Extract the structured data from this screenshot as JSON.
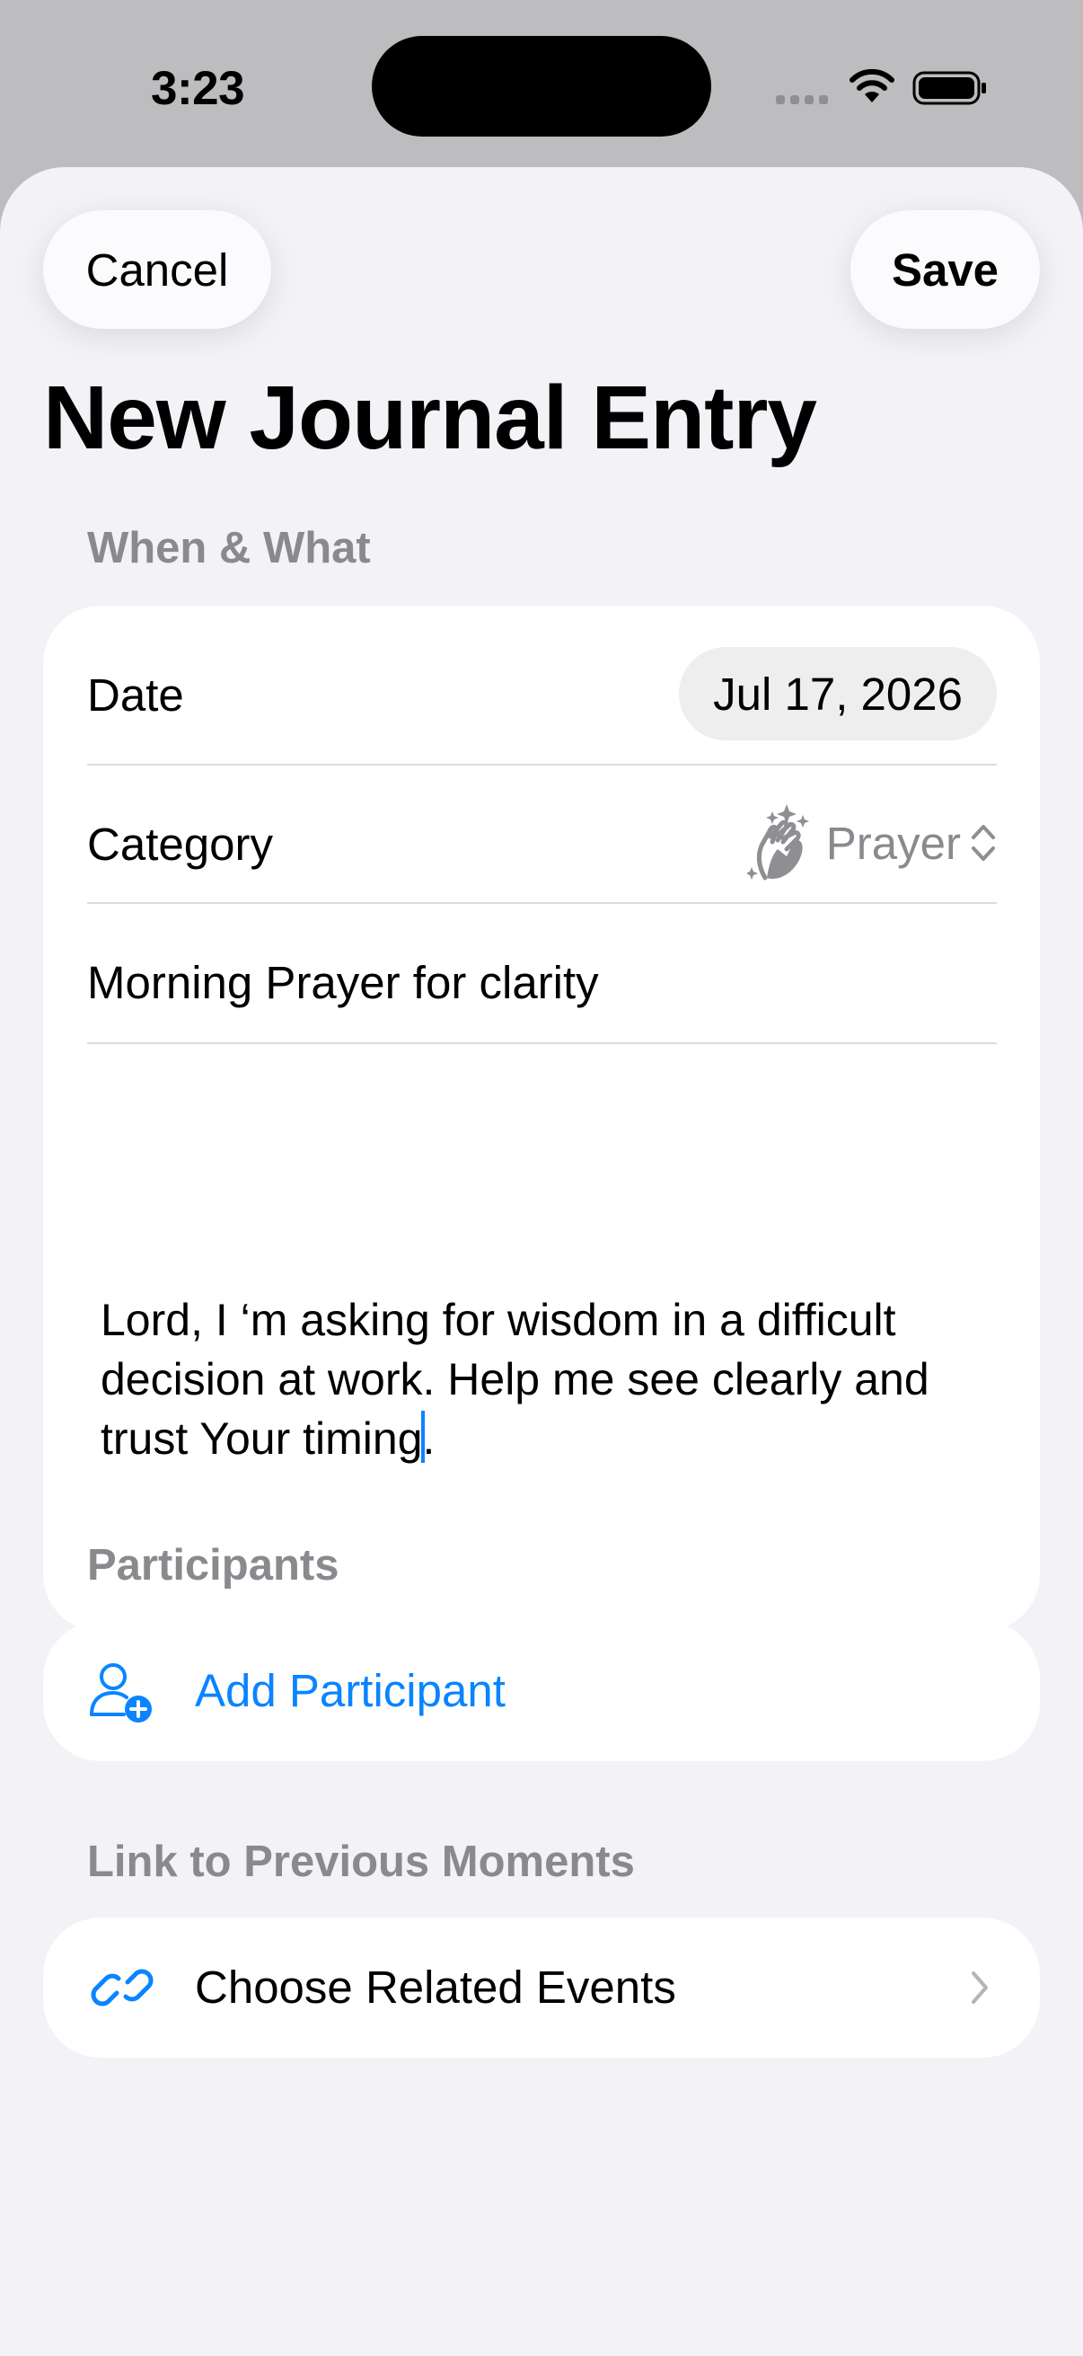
{
  "status_bar": {
    "time": "3:23"
  },
  "toolbar": {
    "cancel_label": "Cancel",
    "save_label": "Save"
  },
  "page": {
    "title": "New Journal Entry"
  },
  "when_what": {
    "header": "When & What",
    "date_label": "Date",
    "date_value": "Jul 17, 2026",
    "category_label": "Category",
    "category_value": "Prayer",
    "category_icon": "praying-hands-sparkles-icon",
    "title_value": "Morning Prayer for clarity",
    "body_before_caret": "Lord, I ‘m asking for wisdom in a difficult decision at work. Help me see clearly and trust Your timing",
    "body_after_caret": "."
  },
  "participants": {
    "header": "Participants",
    "add_label": "Add Participant",
    "add_icon": "person-add-icon"
  },
  "links": {
    "header": "Link to Previous Moments",
    "choose_label": "Choose Related Events",
    "choose_icon": "link-icon"
  },
  "colors": {
    "accent": "#0a84ff",
    "background": "#f2f2f7",
    "secondary_text": "#8a8a8e"
  }
}
